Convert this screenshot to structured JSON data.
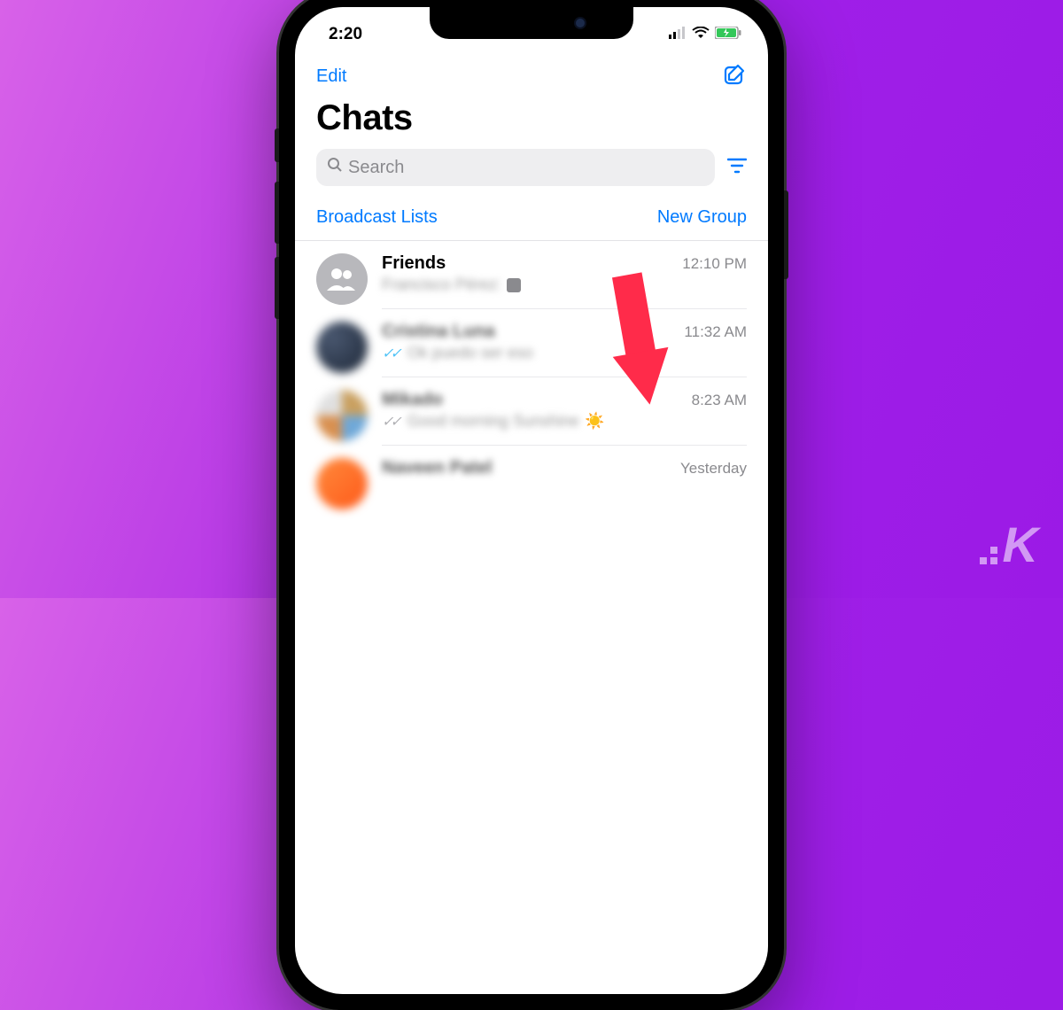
{
  "status": {
    "time": "2:20"
  },
  "nav": {
    "edit": "Edit"
  },
  "title": "Chats",
  "search": {
    "placeholder": "Search"
  },
  "action_links": {
    "broadcast": "Broadcast Lists",
    "new_group": "New Group"
  },
  "chats": [
    {
      "name": "Friends",
      "time": "12:10 PM",
      "preview": "Francisco Pérez:",
      "avatar_type": "group",
      "read_state": "none",
      "show_sticker": true,
      "name_blurred": false
    },
    {
      "name": "Cristina Luna",
      "time": "11:32 AM",
      "preview": "Ok puedo ser eso",
      "avatar_type": "blur2",
      "read_state": "read",
      "show_sticker": false,
      "name_blurred": true
    },
    {
      "name": "Mikado",
      "time": "8:23 AM",
      "preview": "Good morning Sunshine",
      "avatar_type": "blur3",
      "read_state": "delivered",
      "show_sticker": false,
      "show_sun": true,
      "name_blurred": true
    },
    {
      "name": "Naveen Patel",
      "time": "Yesterday",
      "preview": "",
      "avatar_type": "blur4",
      "read_state": "none",
      "show_sticker": false,
      "name_blurred": true
    }
  ],
  "logo": {
    "letter": "K"
  }
}
